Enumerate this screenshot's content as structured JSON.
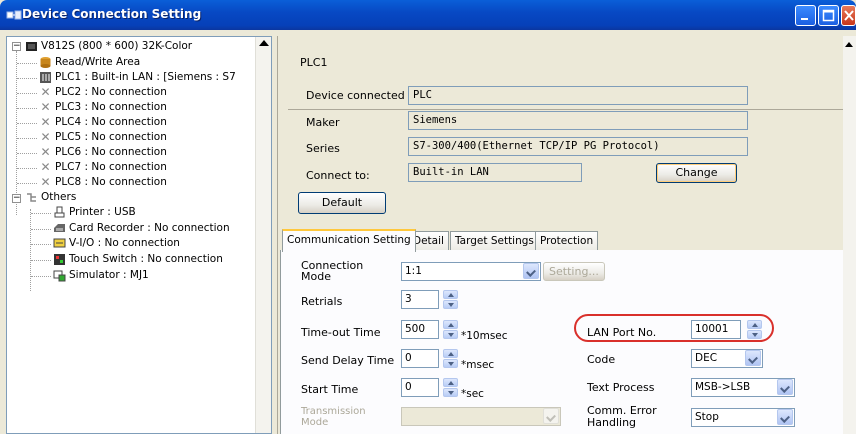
{
  "window": {
    "title": "Device Connection Setting"
  },
  "tree": {
    "root": "V812S (800 * 600) 32K-Color",
    "items": [
      "Read/Write Area",
      "PLC1 : Built-in LAN : [Siemens : S7",
      "PLC2 : No connection",
      "PLC3 : No connection",
      "PLC4 : No connection",
      "PLC5 : No connection",
      "PLC6 : No connection",
      "PLC7 : No connection",
      "PLC8 : No connection"
    ],
    "others": "Others",
    "others_items": [
      "Printer : USB",
      "Card Recorder : No connection",
      "V-I/O : No connection",
      "Touch Switch : No connection",
      "Simulator : MJ1"
    ]
  },
  "header": {
    "plc": "PLC1"
  },
  "fields": {
    "device_label": "Device connected",
    "device_value": "PLC",
    "maker_label": "Maker",
    "maker_value": "Siemens",
    "series_label": "Series",
    "series_value": "S7-300/400(Ethernet TCP/IP PG Protocol)",
    "connect_label": "Connect to:",
    "connect_value": "Built-in LAN",
    "change_button": "Change",
    "default_button": "Default"
  },
  "tabs": [
    "Communication Setting",
    "Detail",
    "Target Settings",
    "Protection"
  ],
  "comm": {
    "connection_mode_label": "Connection Mode",
    "connection_mode_value": "1:1",
    "setting_button": "Setting...",
    "retrials_label": "Retrials",
    "retrials_value": "3",
    "timeout_label": "Time-out Time",
    "timeout_value": "500",
    "timeout_unit": "*10msec",
    "send_delay_label": "Send Delay Time",
    "send_delay_value": "0",
    "send_delay_unit": "*msec",
    "start_time_label": "Start Time",
    "start_time_value": "0",
    "start_time_unit": "*sec",
    "transmission_label": "Transmission Mode",
    "lan_port_label": "LAN Port No.",
    "lan_port_value": "10001",
    "code_label": "Code",
    "code_value": "DEC",
    "text_process_label": "Text Process",
    "text_process_value": "MSB->LSB",
    "comm_error_label": "Comm. Error Handling",
    "comm_error_value": "Stop"
  },
  "colors": {
    "titlebar": "#0749c4",
    "highlight_ring": "#d9302b",
    "active_tab": "#ffc83c"
  }
}
